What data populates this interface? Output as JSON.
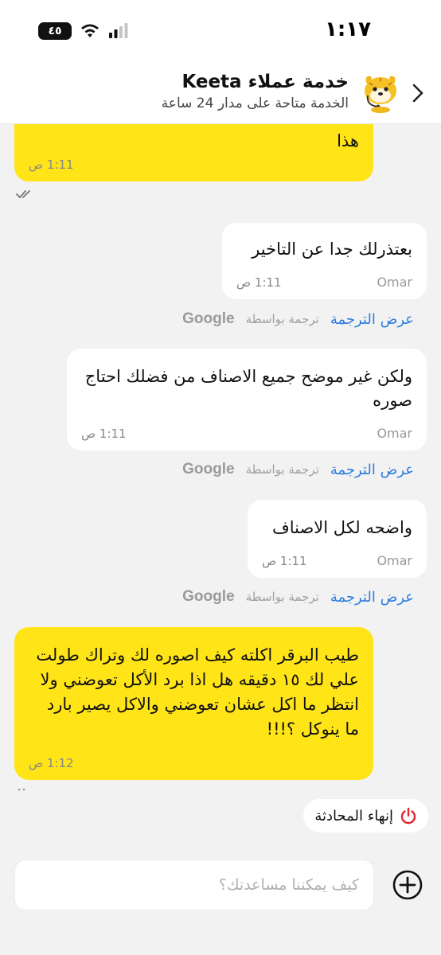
{
  "status_bar": {
    "time": "١:١٧",
    "battery": "٤٥"
  },
  "header": {
    "title": "خدمة عملاء Keeta",
    "subtitle": "الخدمة متاحة على مدار 24 ساعة"
  },
  "messages": [
    {
      "from": "me",
      "text": "هذا",
      "time": "1:11 ص"
    },
    {
      "from": "agent",
      "text": "بعتذرلك جدا عن التاخير",
      "sender": "Omar",
      "time": "1:11 ص"
    },
    {
      "from": "agent",
      "text": "ولكن غير موضح جميع الاصناف من فضلك احتاج صوره",
      "sender": "Omar",
      "time": "1:11 ص"
    },
    {
      "from": "agent",
      "text": "واضحه لكل الاصناف",
      "sender": "Omar",
      "time": "1:11 ص"
    },
    {
      "from": "me",
      "text": "طيب البرقر اكلته كيف اصوره لك وتراك طولت علي لك ١٥ دقيقه هل اذا برد الأكل تعوضني ولا انتظر ما اكل عشان تعوضني والاكل يصير بارد ما ينوكل ؟!!!",
      "time": "1:12 ص"
    }
  ],
  "translation": {
    "show_label": "عرض الترجمة",
    "by_label": "ترجمة بواسطة",
    "provider": "Google"
  },
  "end_chat_label": "إنهاء المحادثة",
  "input": {
    "placeholder": "كيف يمكننا مساعدتك؟"
  },
  "colors": {
    "my_bubble": "#ffe417",
    "agent_bubble": "#ffffff",
    "link": "#2b7de0",
    "end_icon": "#e0282e"
  }
}
